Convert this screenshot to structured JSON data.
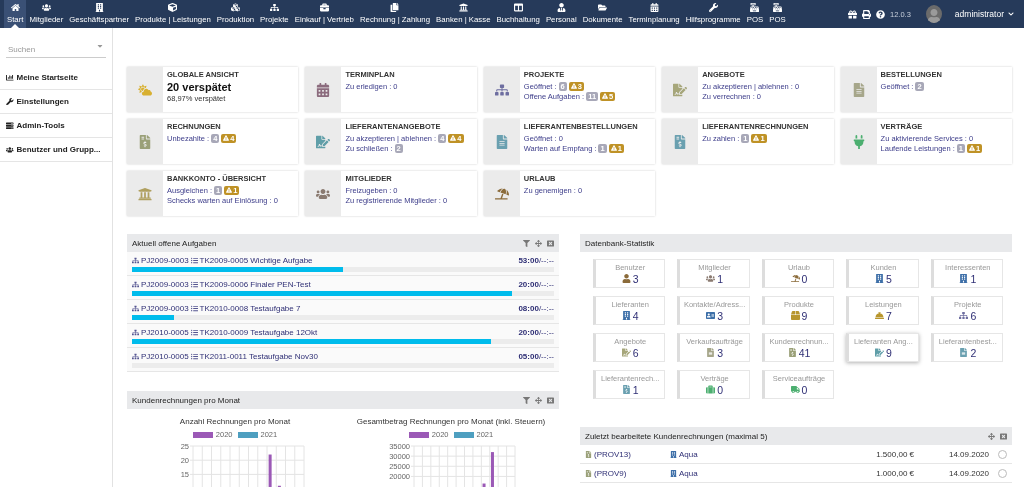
{
  "nav": {
    "items": [
      {
        "label": "Start",
        "selected": true
      },
      {
        "label": "Mitglieder",
        "selected": false
      },
      {
        "label": "Geschäftspartner",
        "selected": false
      },
      {
        "label": "Produkte | Leistungen",
        "selected": false
      },
      {
        "label": "Produktion",
        "selected": false
      },
      {
        "label": "Projekte",
        "selected": false
      },
      {
        "label": "Einkauf | Vertrieb",
        "selected": false
      },
      {
        "label": "Rechnung | Zahlung",
        "selected": false
      },
      {
        "label": "Banken | Kasse",
        "selected": false
      },
      {
        "label": "Buchhaltung",
        "selected": false
      },
      {
        "label": "Personal",
        "selected": false
      },
      {
        "label": "Dokumente",
        "selected": false
      },
      {
        "label": "Terminplanung",
        "selected": false
      },
      {
        "label": "Hilfsprogramme",
        "selected": false
      },
      {
        "label": "POS",
        "selected": false
      },
      {
        "label": "POS",
        "selected": false
      }
    ],
    "version": "12.0.3",
    "user": "administrator"
  },
  "sidebar": {
    "search_placeholder": "Suchen",
    "items": [
      "Meine Startseite",
      "Einstellungen",
      "Admin-Tools",
      "Benutzer und Grupp..."
    ]
  },
  "widgets": [
    {
      "kind": "summary",
      "title": "GLOBALE ANSICHT",
      "headline": "20 verspätet",
      "subline": "68,97% verspätet"
    },
    {
      "kind": "list",
      "title": "TERMINPLAN",
      "lines": [
        {
          "text": "Zu erledigen : 0"
        }
      ]
    },
    {
      "kind": "list",
      "title": "PROJEKTE",
      "lines": [
        {
          "text": "Geöffnet :",
          "badges": [
            {
              "kind": "count",
              "text": "6"
            },
            {
              "kind": "warning",
              "text": "3"
            }
          ]
        },
        {
          "text": "Offene Aufgaben :",
          "badges": [
            {
              "kind": "count",
              "text": "11"
            },
            {
              "kind": "warning",
              "text": "5"
            }
          ]
        }
      ]
    },
    {
      "kind": "list",
      "title": "ANGEBOTE",
      "lines": [
        {
          "text": "Zu akzeptieren | ablehnen : 0"
        },
        {
          "text": "Zu verrechnen : 0"
        }
      ]
    },
    {
      "kind": "list",
      "title": "BESTELLUNGEN",
      "lines": [
        {
          "text": "Geöffnet :",
          "badges": [
            {
              "kind": "count",
              "text": "2"
            }
          ]
        }
      ]
    },
    {
      "kind": "list",
      "title": "RECHNUNGEN",
      "lines": [
        {
          "text": "Unbezahlte :",
          "badges": [
            {
              "kind": "count",
              "text": "4"
            },
            {
              "kind": "warning",
              "text": "4"
            }
          ]
        }
      ]
    },
    {
      "kind": "list",
      "title": "LIEFERANTENANGEBOTE",
      "lines": [
        {
          "text": "Zu akzeptieren | ablehnen :",
          "badges": [
            {
              "kind": "count",
              "text": "4"
            },
            {
              "kind": "warning",
              "text": "4"
            }
          ]
        },
        {
          "text": "Zu schließen :",
          "badges": [
            {
              "kind": "count",
              "text": "2"
            }
          ]
        }
      ]
    },
    {
      "kind": "list",
      "title": "LIEFERANTENBESTELLUNGEN",
      "lines": [
        {
          "text": "Geöffnet : 0"
        },
        {
          "text": "Warten auf Empfang :",
          "badges": [
            {
              "kind": "count",
              "text": "1"
            },
            {
              "kind": "warning",
              "text": "1"
            }
          ]
        }
      ]
    },
    {
      "kind": "list",
      "title": "LIEFERANTENRECHNUNGEN",
      "lines": [
        {
          "text": "Zu zahlen :",
          "badges": [
            {
              "kind": "count",
              "text": "1"
            },
            {
              "kind": "warning",
              "text": "1"
            }
          ]
        }
      ]
    },
    {
      "kind": "list",
      "title": "VERTRÄGE",
      "lines": [
        {
          "text": "Zu aktivierende Services : 0"
        },
        {
          "text": "Laufende Leistungen :",
          "badges": [
            {
              "kind": "count",
              "text": "1"
            },
            {
              "kind": "warning",
              "text": "1"
            }
          ]
        }
      ]
    },
    {
      "kind": "list",
      "title": "BANKKONTO - ÜBERSICHT",
      "lines": [
        {
          "text": "Ausgleichen :",
          "badges": [
            {
              "kind": "count",
              "text": "1"
            },
            {
              "kind": "warning",
              "text": "1"
            }
          ]
        },
        {
          "text": "Schecks warten auf Einlösung : 0"
        }
      ]
    },
    {
      "kind": "list",
      "title": "MITGLIEDER",
      "lines": [
        {
          "text": "Freizugeben : 0"
        },
        {
          "text": "Zu registrierende Mitglieder : 0"
        }
      ]
    },
    {
      "kind": "list",
      "title": "URLAUB",
      "lines": [
        {
          "text": "Zu genemigen : 0"
        }
      ]
    }
  ],
  "tasks": {
    "title": "Aktuell offene Aufgaben",
    "rows": [
      {
        "project": "PJ2009-0003",
        "task": "TK2009-0005 Wichtige Aufgabe",
        "time": "**53:00**/--:--",
        "level": 0.5
      },
      {
        "project": "PJ2009-0003",
        "task": "TK2009-0006 Finaler PEN-Test",
        "time": "**20:00**/--:--",
        "level": 0.9
      },
      {
        "project": "PJ2009-0003",
        "task": "TK2010-0008 Testaufgabe 7",
        "time": "**08:00**/--:--",
        "level": 0.1
      },
      {
        "project": "PJ2010-0005",
        "task": "TK2010-0009 Testaufgabe 12Okt",
        "time": "**20:00**/--:--",
        "level": 0.85
      },
      {
        "project": "PJ2010-0005",
        "task": "TK2011-0011 Testaufgabe Nov30",
        "time": "**05:00**/--:--",
        "level": 0
      }
    ]
  },
  "invoices_chart": {
    "title": "Kundenrechnungen pro Monat",
    "charts": [
      {
        "chart_data": {
          "type": "bar",
          "title": "Anzahl Rechnungen pro Monat",
          "grid": true,
          "series": [
            {
              "name": "2020",
              "color": "#9b59b6",
              "values": [
                null,
                null,
                null,
                null,
                null,
                null,
                null,
                null,
                22,
                11,
                null,
                null
              ]
            },
            {
              "name": "2021",
              "color": "#4e9fc0",
              "values": [
                null,
                null,
                null,
                null,
                null,
                null,
                null,
                null,
                null,
                null,
                null,
                null
              ]
            }
          ],
          "ylim": [
            0,
            25
          ],
          "yticks": [
            15,
            20,
            25
          ]
        }
      },
      {
        "chart_data": {
          "type": "bar",
          "title": "Gesamtbetrag Rechnungen pro Monat (inkl. Steuern)",
          "grid": true,
          "series": [
            {
              "name": "2020",
              "color": "#9b59b6",
              "values": [
                null,
                null,
                null,
                null,
                null,
                null,
                null,
                null,
                16500,
                32000,
                null,
                null
              ]
            },
            {
              "name": "2021",
              "color": "#4e9fc0",
              "values": [
                null,
                null,
                null,
                null,
                null,
                null,
                null,
                null,
                null,
                null,
                null,
                null
              ]
            }
          ],
          "ylim": [
            0,
            35000
          ],
          "yticks": [
            20000,
            25000,
            30000,
            35000
          ]
        }
      }
    ]
  },
  "stats": {
    "title": "Datenbank-Statistik",
    "tiles": [
      {
        "label": "Benutzer",
        "count": "3",
        "hovered": false
      },
      {
        "label": "Mitglieder",
        "count": "1",
        "hovered": false
      },
      {
        "label": "Urlaub",
        "count": "0",
        "hovered": false
      },
      {
        "label": "Kunden",
        "count": "5",
        "hovered": false
      },
      {
        "label": "Interessenten",
        "count": "1",
        "hovered": false
      },
      {
        "label": "Lieferanten",
        "count": "4",
        "hovered": false
      },
      {
        "label": "Kontakte/Adress...",
        "count": "3",
        "hovered": false
      },
      {
        "label": "Produkte",
        "count": "9",
        "hovered": false
      },
      {
        "label": "Leistungen",
        "count": "7",
        "hovered": false
      },
      {
        "label": "Projekte",
        "count": "6",
        "hovered": false
      },
      {
        "label": "Angebote",
        "count": "6",
        "hovered": false
      },
      {
        "label": "Verkaufsaufträge",
        "count": "3",
        "hovered": false
      },
      {
        "label": "Kundenrechnun...",
        "count": "41",
        "hovered": false
      },
      {
        "label": "Lieferanten Ang...",
        "count": "9",
        "hovered": true
      },
      {
        "label": "Lieferantenbest...",
        "count": "2",
        "hovered": false
      },
      {
        "label": "Lieferantenrech...",
        "count": "1",
        "hovered": false
      },
      {
        "label": "Verträge",
        "count": "0",
        "hovered": false
      },
      {
        "label": "Serviceaufträge",
        "count": "0",
        "hovered": false
      }
    ]
  },
  "recent": {
    "title": "Zuletzt bearbeitete Kundenrechnungen (maximal 5)",
    "rows": [
      {
        "ref": "(PROV13)",
        "customer": "Aqua",
        "amount": "1.500,00 €",
        "date": "14.09.2020",
        "selected": false
      },
      {
        "ref": "(PROV9)",
        "customer": "Aqua",
        "amount": "1.000,00 €",
        "date": "14.09.2020",
        "selected": false
      }
    ]
  }
}
